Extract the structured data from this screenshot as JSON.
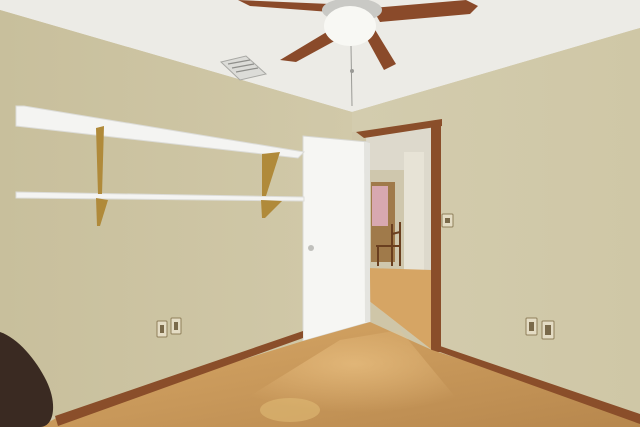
{
  "scene": {
    "description_colors": {
      "ceiling": "#ecebe7",
      "wall_left": "#cdc5a4",
      "wall_right": "#d2cbac",
      "floor": "#c99a5c",
      "trim": "#8a4e2a",
      "door": "#f7f7f5",
      "shelf": "#f4f4f2",
      "bracket": "#b08a3a"
    },
    "icons": {
      "ceiling_fan": "ceiling-fan-icon",
      "air_vent": "air-vent-icon",
      "light_switch": "light-switch-icon",
      "outlet": "electrical-outlet-icon",
      "door_knob": "door-knob-icon",
      "chair": "chair-icon",
      "guitar_case": "guitar-case-icon"
    }
  }
}
